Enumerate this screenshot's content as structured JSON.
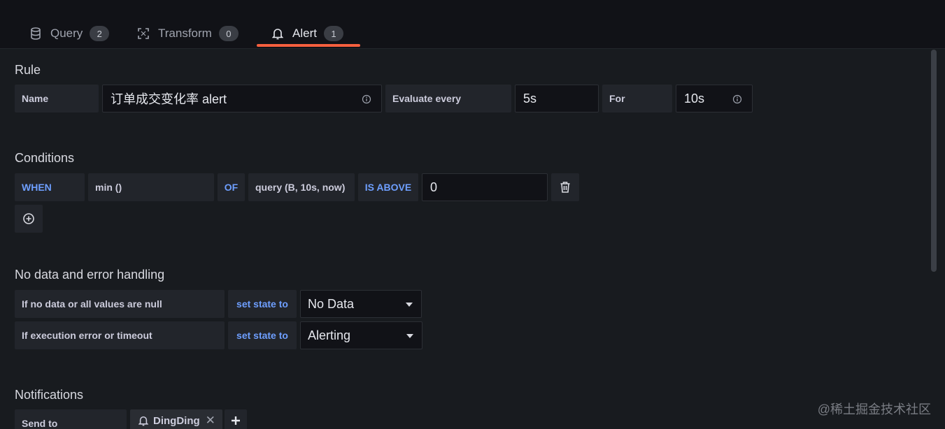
{
  "tabs": [
    {
      "label": "Query",
      "count": "2",
      "icon": "database-icon"
    },
    {
      "label": "Transform",
      "count": "0",
      "icon": "transform-icon"
    },
    {
      "label": "Alert",
      "count": "1",
      "icon": "bell-icon",
      "active": true
    }
  ],
  "accent_color": "#f55f3e",
  "rule": {
    "title": "Rule",
    "name_label": "Name",
    "name_value": "订单成交变化率 alert",
    "evaluate_label": "Evaluate every",
    "evaluate_value": "5s",
    "for_label": "For",
    "for_value": "10s"
  },
  "conditions": {
    "title": "Conditions",
    "when": "WHEN",
    "reducer": "min ()",
    "of": "OF",
    "query": "query (B, 10s, now)",
    "evaluator": "IS ABOVE",
    "threshold": "0"
  },
  "nodata": {
    "title": "No data and error handling",
    "row1_label": "If no data or all values are null",
    "row1_action": "set state to",
    "row1_value": "No Data",
    "row2_label": "If execution error or timeout",
    "row2_action": "set state to",
    "row2_value": "Alerting"
  },
  "notifications": {
    "title": "Notifications",
    "send_to_label": "Send to",
    "channel": "DingDing"
  },
  "watermark": "@稀土掘金技术社区"
}
